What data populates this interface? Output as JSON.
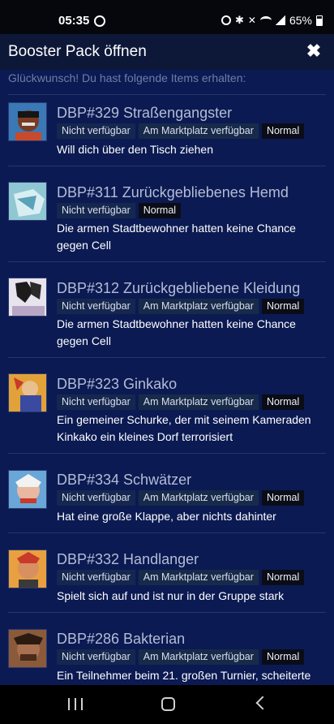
{
  "status_bar": {
    "time": "05:35",
    "battery_percent": "65%",
    "battery_level": 0.65,
    "icons": [
      "alarm-icon",
      "bluetooth-icon",
      "mute-icon",
      "wifi-icon",
      "signal-icon",
      "battery-icon"
    ]
  },
  "header": {
    "title": "Booster Pack öffnen",
    "close_icon": "✖"
  },
  "intro": "Glückwunsch! Du hast folgende Items erhalten:",
  "items": [
    {
      "title": "DBP#329 Straßengangster",
      "tags": [
        "Nicht verfügbar",
        "Am Marktplatz verfügbar",
        "Normal"
      ],
      "description": "Will dich über den Tisch ziehen"
    },
    {
      "title": "DBP#311 Zurückgebliebenes Hemd",
      "tags": [
        "Nicht verfügbar",
        "Normal"
      ],
      "description": "Die armen Stadtbewohner hatten keine Chance gegen Cell"
    },
    {
      "title": "DBP#312 Zurückgebliebene Kleidung",
      "tags": [
        "Nicht verfügbar",
        "Am Marktplatz verfügbar",
        "Normal"
      ],
      "description": "Die armen Stadtbewohner hatten keine Chance gegen Cell"
    },
    {
      "title": "DBP#323 Ginkako",
      "tags": [
        "Nicht verfügbar",
        "Am Marktplatz verfügbar",
        "Normal"
      ],
      "description": "Ein gemeiner Schurke, der mit seinem Kameraden Kinkako ein kleines Dorf terrorisiert"
    },
    {
      "title": "DBP#334 Schwätzer",
      "tags": [
        "Nicht verfügbar",
        "Am Marktplatz verfügbar",
        "Normal"
      ],
      "description": "Hat eine große Klappe, aber nichts dahinter"
    },
    {
      "title": "DBP#332 Handlanger",
      "tags": [
        "Nicht verfügbar",
        "Am Marktplatz verfügbar",
        "Normal"
      ],
      "description": "Spielt sich auf und ist nur in der Gruppe stark"
    },
    {
      "title": "DBP#286 Bakterian",
      "tags": [
        "Nicht verfügbar",
        "Am Marktplatz verfügbar",
        "Normal"
      ],
      "description": "Ein Teilnehmer beim 21. großen Turnier, scheiterte"
    }
  ],
  "nav": {
    "icons": [
      "recent-apps-icon",
      "home-icon",
      "back-icon"
    ]
  },
  "colors": {
    "background": "#0b1a52",
    "header": "#0d1838",
    "title_text": "#b4bcd4",
    "intro_text": "#6e7ea6",
    "normal_tag": "#0a0d18"
  }
}
